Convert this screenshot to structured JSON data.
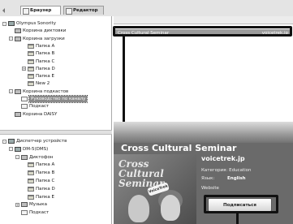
{
  "tabs": [
    {
      "label": "Браузер",
      "active": true
    },
    {
      "label": "Редактор",
      "active": false
    }
  ],
  "left_tree_top": [
    {
      "label": "Olympus Sonority",
      "indent": 0,
      "expander": "-",
      "icon": "device"
    },
    {
      "label": "Корзина диктовки",
      "indent": 1,
      "expander": "",
      "icon": "box"
    },
    {
      "label": "Корзина загрузки",
      "indent": 1,
      "expander": "-",
      "icon": "box"
    },
    {
      "label": "Папка A",
      "indent": 3,
      "expander": "",
      "icon": "folder"
    },
    {
      "label": "Папка B",
      "indent": 3,
      "expander": "",
      "icon": "folder"
    },
    {
      "label": "Папка C",
      "indent": 3,
      "expander": "",
      "icon": "folder"
    },
    {
      "label": "Папка D",
      "indent": 3,
      "expander": "+",
      "icon": "folder"
    },
    {
      "label": "Папка E",
      "indent": 3,
      "expander": "",
      "icon": "folder"
    },
    {
      "label": "New 2",
      "indent": 3,
      "expander": "",
      "icon": "folder"
    },
    {
      "label": "Корзина подкастов",
      "indent": 1,
      "expander": "-",
      "icon": "box"
    },
    {
      "label": "Руководство по каналу",
      "indent": 2,
      "expander": "",
      "icon": "note",
      "selected": true
    },
    {
      "label": "Подкаст",
      "indent": 2,
      "expander": "",
      "icon": "note"
    },
    {
      "label": "Корзина DAISY",
      "indent": 1,
      "expander": "",
      "icon": "box"
    }
  ],
  "left_tree_bottom": [
    {
      "label": "Диспетчер устройств",
      "indent": 0,
      "expander": "-",
      "icon": "device"
    },
    {
      "label": "DM-5(DMS)",
      "indent": 1,
      "expander": "-",
      "icon": "device"
    },
    {
      "label": "Диктофон",
      "indent": 2,
      "expander": "-",
      "icon": "box"
    },
    {
      "label": "Папка A",
      "indent": 3,
      "expander": "",
      "icon": "folder"
    },
    {
      "label": "Папка B",
      "indent": 3,
      "expander": "",
      "icon": "folder"
    },
    {
      "label": "Папка C",
      "indent": 3,
      "expander": "",
      "icon": "folder"
    },
    {
      "label": "Папка D",
      "indent": 3,
      "expander": "",
      "icon": "folder"
    },
    {
      "label": "Папка E",
      "indent": 3,
      "expander": "",
      "icon": "folder"
    },
    {
      "label": "Музыка",
      "indent": 2,
      "expander": "+",
      "icon": "box"
    },
    {
      "label": "Подкаст",
      "indent": 2,
      "expander": "",
      "icon": "note"
    }
  ],
  "list": {
    "selected_row": {
      "name": "Cross Cultural Seminar",
      "site": "voicetrek.jp"
    }
  },
  "podcast": {
    "title": "Cross Cultural Seminar",
    "art_lines": [
      "Cross",
      "Cultural",
      "Seminar"
    ],
    "site": "voicetrek.jp",
    "category_label": "Категория:",
    "category_value": "Education",
    "language_label": "Язык:",
    "language_value": "English",
    "website_label": "Website",
    "subscribe_label": "Подписаться"
  }
}
